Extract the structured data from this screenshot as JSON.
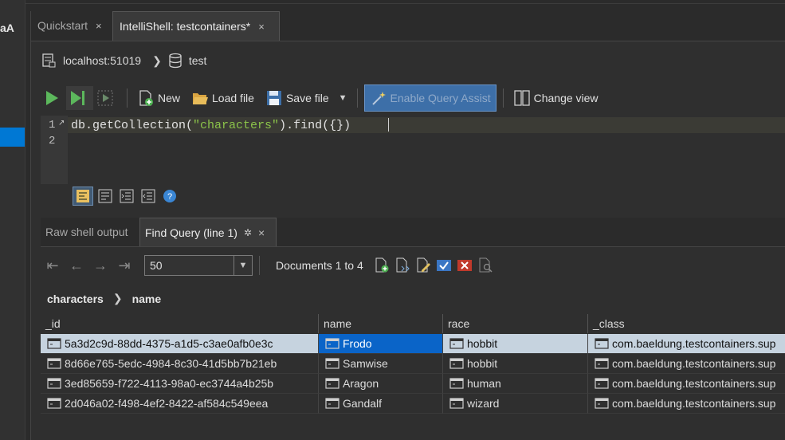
{
  "left_strip": {
    "label": "aA"
  },
  "tabs": [
    {
      "label": "Quickstart",
      "close": "×"
    },
    {
      "label": "IntelliShell: testcontainers*",
      "close": "×"
    }
  ],
  "breadcrumb": {
    "host": "localhost:51019",
    "database": "test"
  },
  "toolbar": {
    "new_label": "New",
    "load_label": "Load file",
    "save_label": "Save file",
    "assist_label": "Enable Query Assist",
    "change_view_label": "Change view"
  },
  "editor": {
    "line_numbers": [
      "1",
      "2"
    ],
    "code_prefix": "db.getCollection(",
    "code_string": "\"characters\"",
    "code_suffix": ").find({})"
  },
  "results": {
    "tabs": [
      {
        "label": "Raw shell output"
      },
      {
        "label": "Find Query (line 1)",
        "close": "×"
      }
    ],
    "page_size": "50",
    "documents_label": "Documents 1 to 4",
    "path": {
      "collection": "characters",
      "field": "name"
    },
    "columns": [
      "_id",
      "name",
      "race",
      "_class"
    ],
    "rows": [
      [
        "5a3d2c9d-88dd-4375-a1d5-c3ae0afb0e3c",
        "Frodo",
        "hobbit",
        "com.baeldung.testcontainers.sup"
      ],
      [
        "8d66e765-5edc-4984-8c30-41d5bb7b21eb",
        "Samwise",
        "hobbit",
        "com.baeldung.testcontainers.sup"
      ],
      [
        "3ed85659-f722-4113-98a0-ec3744a4b25b",
        "Aragon",
        "human",
        "com.baeldung.testcontainers.sup"
      ],
      [
        "2d046a02-f498-4ef2-8422-af584c549eea",
        "Gandalf",
        "wizard",
        "com.baeldung.testcontainers.sup"
      ]
    ]
  },
  "colors": {
    "accent": "#0078d4",
    "selected_row": "#c6d3df",
    "selected_cell": "#0a64c8",
    "string": "#8bc34a"
  }
}
